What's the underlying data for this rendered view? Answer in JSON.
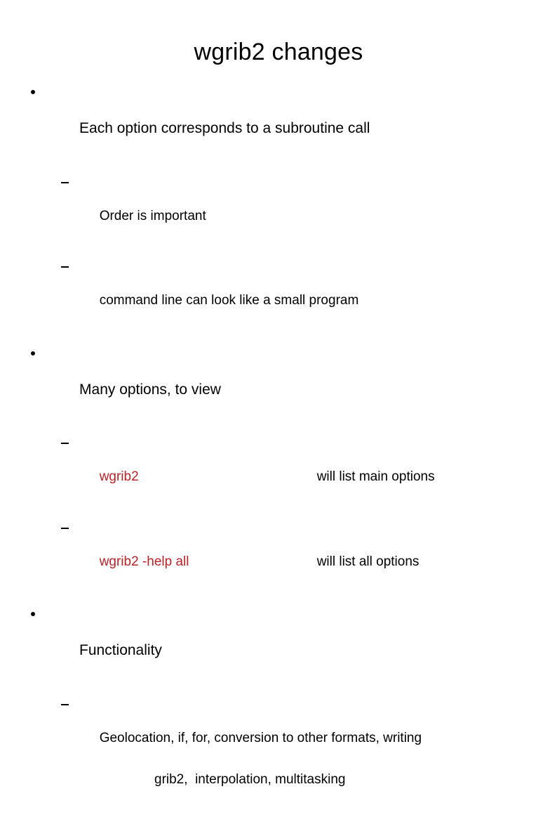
{
  "slide": {
    "title": "wgrib2 changes",
    "background_color": "#FFFFFF",
    "text_color": "#000000",
    "accent_color": "#BE2026",
    "bullets": [
      {
        "level": 1,
        "text": "Each option corresponds to a subroutine call"
      },
      {
        "level": 2,
        "text": "Order is important"
      },
      {
        "level": 2,
        "text": "command line can look like a small program"
      },
      {
        "level": 1,
        "text": "Many options, to view"
      },
      {
        "level": 2,
        "command": "wgrib2",
        "description": "will list main options"
      },
      {
        "level": 2,
        "command": "wgrib2 -help all",
        "description": "will list all options"
      },
      {
        "level": 1,
        "text": "Functionality"
      },
      {
        "level": 2,
        "text_line1": "Geolocation, if, for, conversion to other formats, writing",
        "text_line2": "grib2,  interpolation, multitasking"
      }
    ]
  }
}
